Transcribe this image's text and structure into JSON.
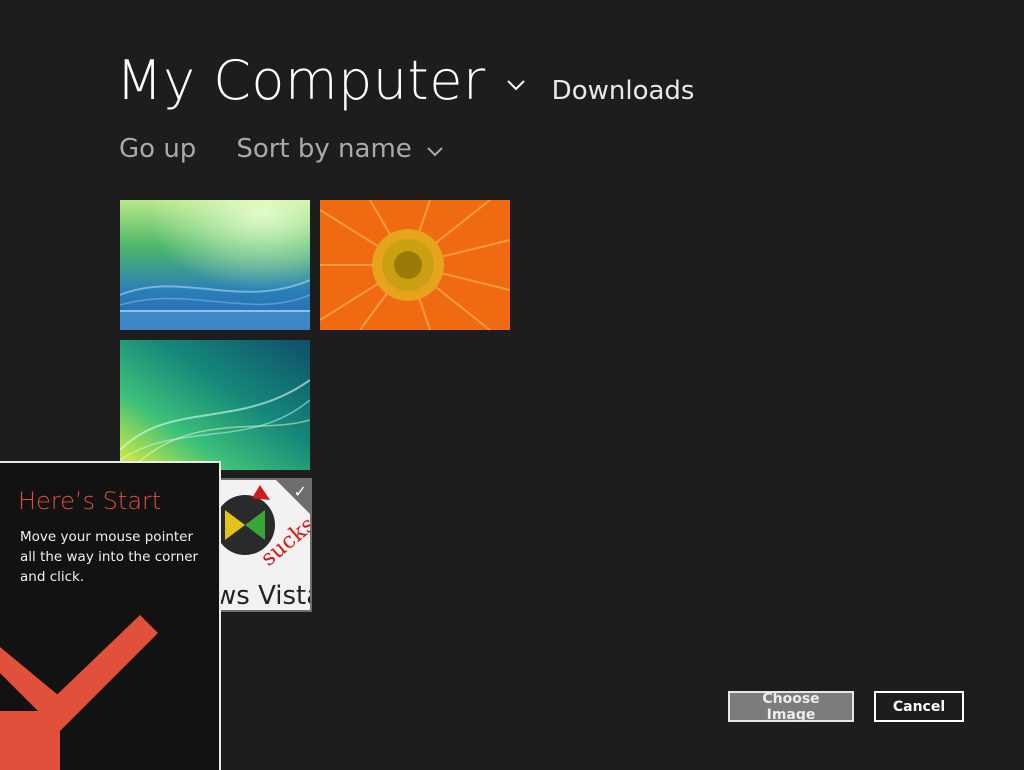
{
  "header": {
    "title": "My Computer",
    "location": "Downloads",
    "title_chevron_icon": "chevron-down-icon"
  },
  "commands": {
    "go_up": "Go up",
    "sort_label": "Sort by name",
    "sort_chevron_icon": "chevron-down-icon"
  },
  "files": [
    {
      "name": "aurora-green-blue-thumbnail",
      "selected": false
    },
    {
      "name": "orange-flower-thumbnail",
      "selected": false
    },
    {
      "name": "aurora-teal-yellow-thumbnail",
      "selected": false
    },
    {
      "name": "vista-sucks-thumbnail",
      "selected": true,
      "text": "ws Vista",
      "scribble": "sucks"
    }
  ],
  "flyout": {
    "title": "Here’s Start",
    "text": "Move your mouse pointer all the way into the corner and click.",
    "arrow_icon": "arrow-down-left-icon"
  },
  "buttons": {
    "choose": "Choose Image",
    "cancel": "Cancel"
  },
  "colors": {
    "background": "#1d1d1d",
    "flyout_accent": "#e0503a",
    "arrow": "#e0503a",
    "button_gray": "#7c7c7c"
  }
}
